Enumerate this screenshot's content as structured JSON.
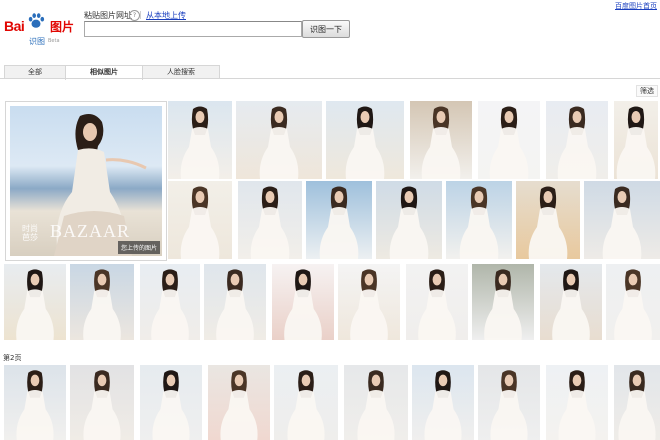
{
  "logo": {
    "brand_bai": "Bai",
    "brand_du": "du",
    "brand_pic": "图片",
    "sub": "识图",
    "beta": "Beta"
  },
  "top_link": "百度图片首页",
  "search": {
    "label": "粘贴图片网址",
    "help": "?",
    "separator": "|",
    "upload_link": "从本地上传",
    "value": "",
    "placeholder": "",
    "button": "识图一下"
  },
  "tabs": [
    {
      "label": "全部",
      "active": false
    },
    {
      "label": "相似图片",
      "active": true
    },
    {
      "label": "人脸搜索",
      "active": false
    }
  ],
  "filter": "筛选",
  "main_image": {
    "badge": "您上传的图片",
    "watermark_cn": "时尚\n芭莎",
    "watermark_en": "BAZAAR"
  },
  "page_label": "第2页",
  "colors": {
    "brand_red": "#e10602",
    "brand_blue": "#2a6ebb",
    "link_blue": "#1a3fbf"
  }
}
